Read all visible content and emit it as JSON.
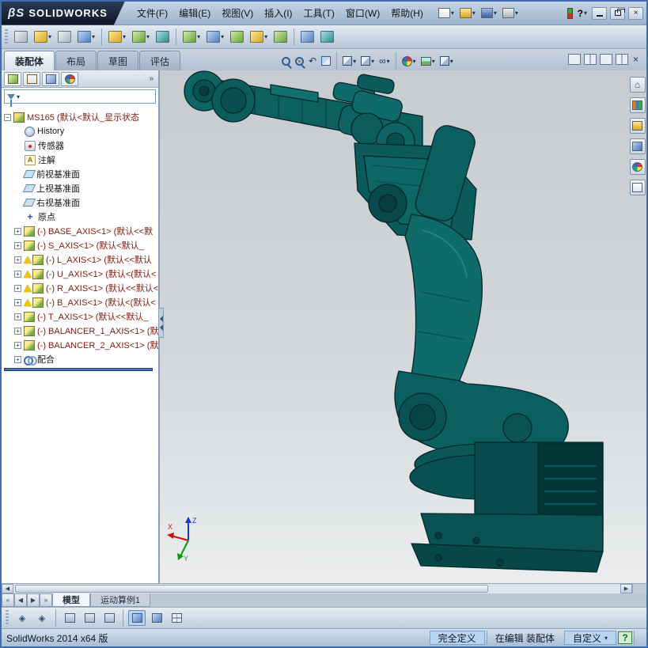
{
  "titlebar": {
    "brand_prefix": "βS",
    "brand": "SOLIDWORKS",
    "menus": [
      "文件(F)",
      "编辑(E)",
      "视图(V)",
      "插入(I)",
      "工具(T)",
      "窗口(W)",
      "帮助(H)"
    ]
  },
  "glyphs": {
    "dropdown": "▾",
    "close": "×",
    "help": "?",
    "home": "⌂",
    "annotation": "A",
    "origin_cross": "+",
    "plus": "+",
    "minus": "−",
    "chevrons": "»",
    "nav_first": "«",
    "nav_prev": "◀",
    "nav_next": "▶",
    "nav_last": "»",
    "scroll_left": "◀",
    "scroll_right": "▶",
    "undo_arrow": "↶",
    "glasses": "∞",
    "diamond": "◈"
  },
  "command_tabs": {
    "items": [
      "装配体",
      "布局",
      "草图",
      "评估"
    ]
  },
  "feature_tree": {
    "root_label": "MS165 (默认<默认_显示状态",
    "items": [
      {
        "label": "History"
      },
      {
        "label": "传感器"
      },
      {
        "label": "注解"
      },
      {
        "label": "前视基准面"
      },
      {
        "label": "上视基准面"
      },
      {
        "label": "右视基准面"
      },
      {
        "label": "原点"
      },
      {
        "label": "(-) BASE_AXIS<1> (默认<<默"
      },
      {
        "label": "(-) S_AXIS<1> (默认<默认_"
      },
      {
        "label": "(-) L_AXIS<1> (默认<<默认"
      },
      {
        "label": "(-) U_AXIS<1> (默认<(默认<"
      },
      {
        "label": "(-) R_AXIS<1> (默认<<默认<"
      },
      {
        "label": "(-) B_AXIS<1> (默认<(默认<"
      },
      {
        "label": "(-) T_AXIS<1> (默认<<默认_"
      },
      {
        "label": "(-) BALANCER_1_AXIS<1> (默"
      },
      {
        "label": "(-) BALANCER_2_AXIS<1> (默"
      },
      {
        "label": "配合"
      }
    ]
  },
  "bottom_tabs": {
    "items": [
      "模型",
      "运动算例1"
    ]
  },
  "statusbar": {
    "app": "SolidWorks 2014 x64 版",
    "defined": "完全定义",
    "editing": "在编辑 装配体",
    "custom": "自定义"
  },
  "colors": {
    "model_teal": "#0d6161",
    "selection_blue": "#b9d4f0",
    "warning_yellow": "#f2c500"
  }
}
